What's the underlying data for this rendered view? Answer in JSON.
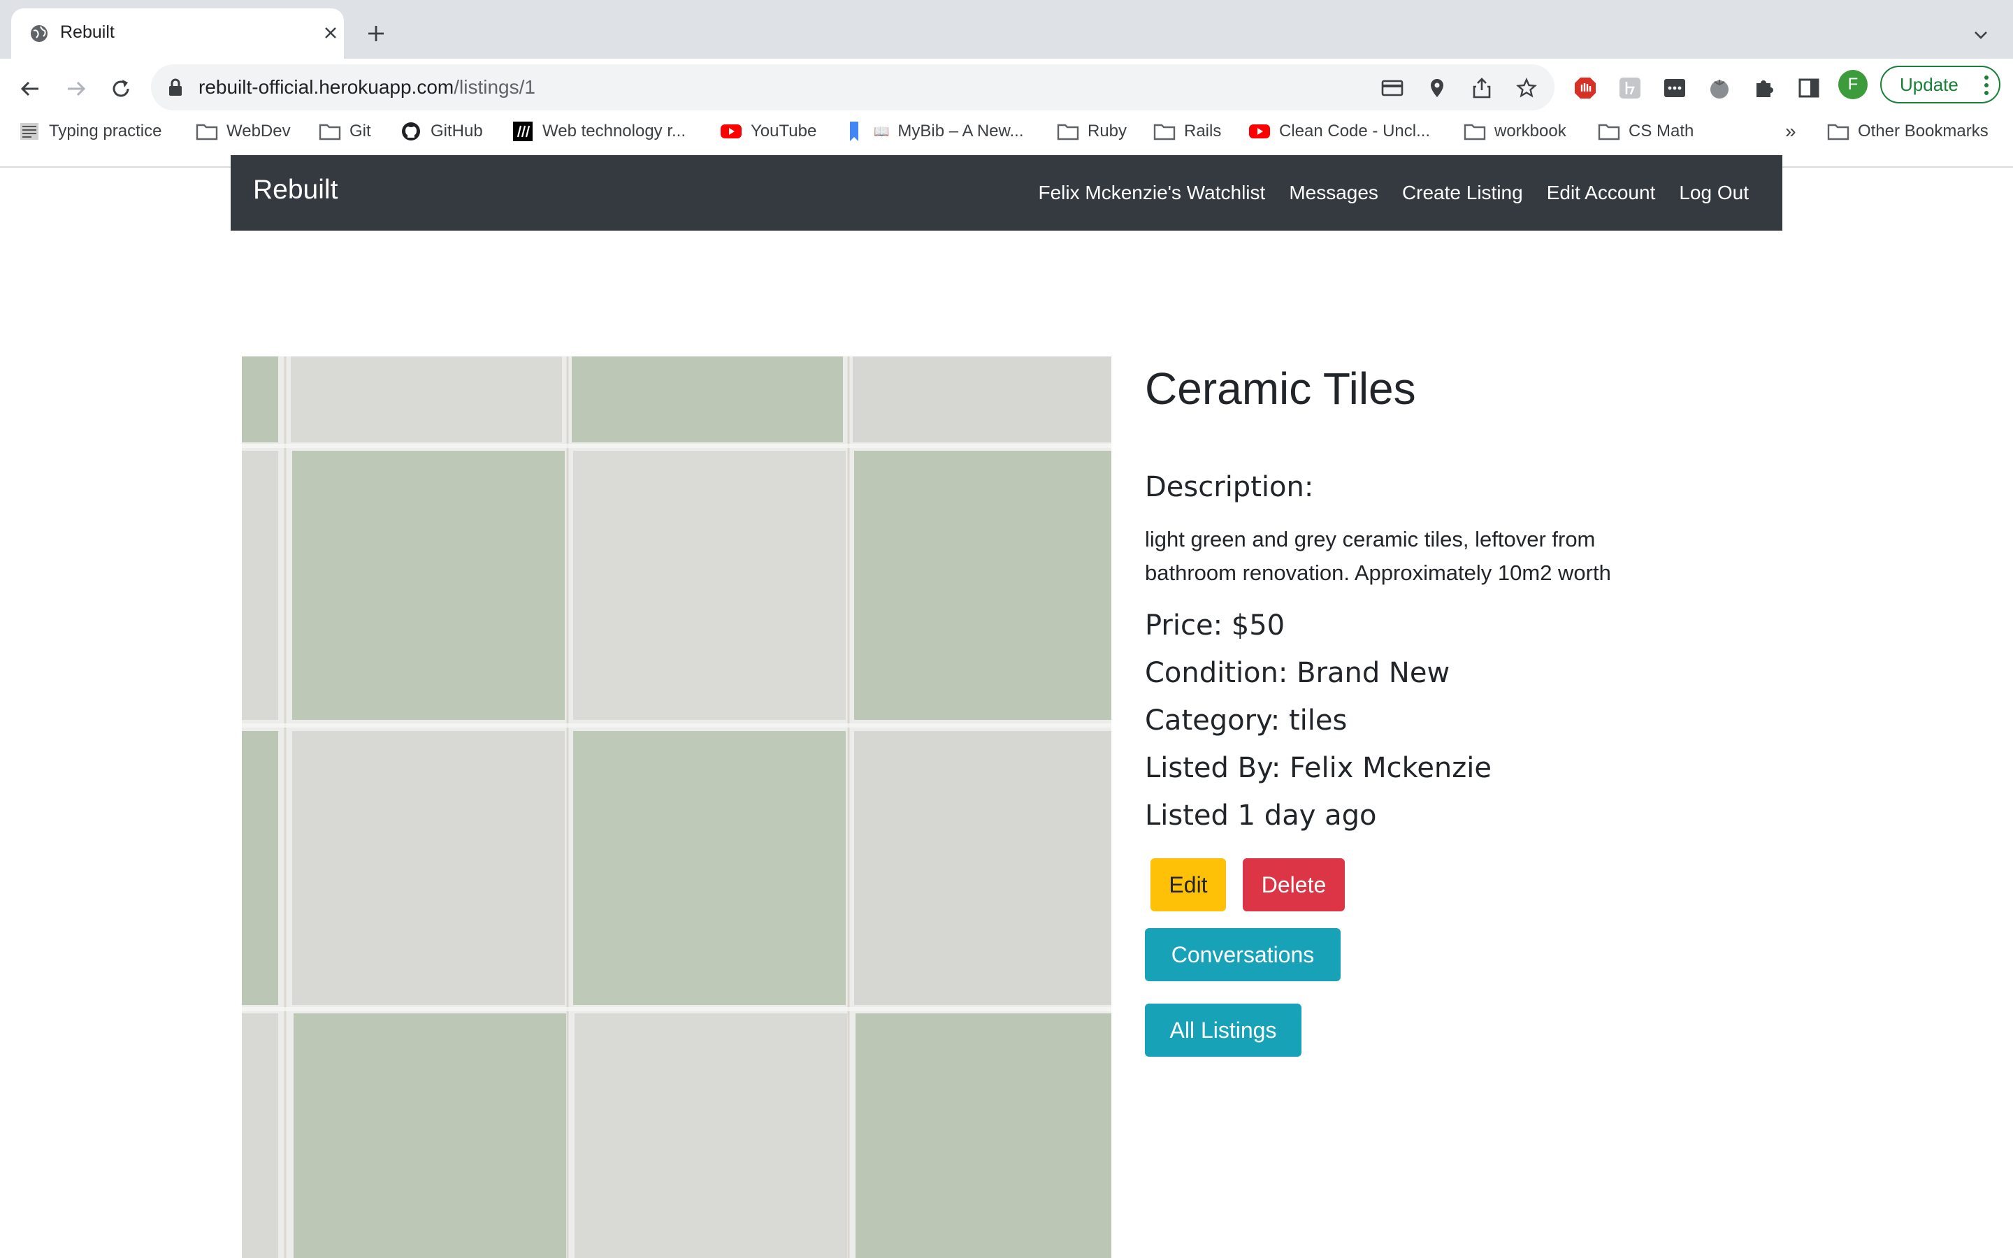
{
  "browser": {
    "tab_title": "Rebuilt",
    "url_host": "rebuilt-official.herokuapp.com",
    "url_path": "/listings/1",
    "update_label": "Update",
    "profile_initial": "F",
    "bookmarks": [
      {
        "label": "Typing practice",
        "icon": "typing-icon"
      },
      {
        "label": "WebDev",
        "icon": "folder-icon"
      },
      {
        "label": "Git",
        "icon": "folder-icon"
      },
      {
        "label": "GitHub",
        "icon": "github-icon"
      },
      {
        "label": "Web technology r...",
        "icon": "mdn-icon"
      },
      {
        "label": "YouTube",
        "icon": "youtube-icon"
      },
      {
        "label": "MyBib – A New...",
        "icon": "bookmark-icon"
      },
      {
        "label": "Ruby",
        "icon": "folder-icon"
      },
      {
        "label": "Rails",
        "icon": "folder-icon"
      },
      {
        "label": "Clean Code - Uncl...",
        "icon": "youtube-icon"
      },
      {
        "label": "workbook",
        "icon": "folder-icon"
      },
      {
        "label": "CS Math",
        "icon": "folder-icon"
      }
    ],
    "bookmarks_overflow": "»",
    "other_bookmarks": "Other Bookmarks"
  },
  "site": {
    "brand": "Rebuilt",
    "nav": {
      "watchlist": "Felix Mckenzie's Watchlist",
      "messages": "Messages",
      "create_listing": "Create Listing",
      "edit_account": "Edit Account",
      "log_out": "Log Out"
    }
  },
  "listing": {
    "title": "Ceramic Tiles",
    "description_label": "Description:",
    "description": "light green and grey ceramic tiles, leftover from bathroom renovation. Approximately 10m2 worth",
    "price": "Price: $50",
    "condition": "Condition: Brand New",
    "category": "Category: tiles",
    "listed_by": "Listed By: Felix Mckenzie",
    "listed_when": "Listed 1 day ago",
    "buttons": {
      "edit": "Edit",
      "delete": "Delete",
      "conversations": "Conversations",
      "all_listings": "All Listings"
    }
  },
  "colors": {
    "navbar": "#343a40",
    "warning": "#ffc107",
    "danger": "#dc3545",
    "info": "#17a2b8",
    "tile_green": "#bcc6b4",
    "tile_grey": "#d8d9d5"
  }
}
